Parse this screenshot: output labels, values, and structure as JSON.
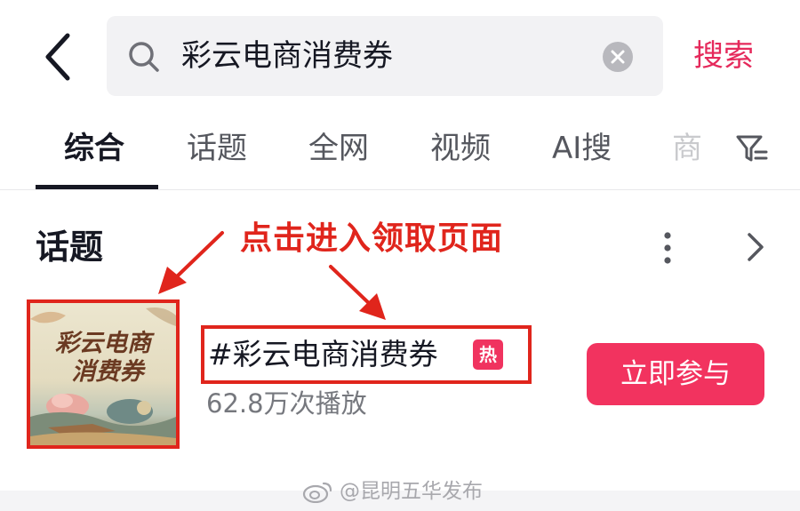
{
  "search": {
    "query": "彩云电商消费券",
    "action_label": "搜索"
  },
  "tabs": [
    {
      "label": "综合",
      "active": true
    },
    {
      "label": "话题",
      "active": false
    },
    {
      "label": "全网",
      "active": false
    },
    {
      "label": "视频",
      "active": false
    },
    {
      "label": "AI搜",
      "active": false
    },
    {
      "label": "商",
      "active": false
    }
  ],
  "section": {
    "title": "话题"
  },
  "annotation": {
    "text": "点击进入领取页面",
    "color": "#e0251c"
  },
  "topic": {
    "thumbnail_line1": "彩云电商",
    "thumbnail_line2": "消费券",
    "title": "#彩云电商消费券",
    "badge": "热",
    "plays": "62.8万次播放",
    "join_label": "立即参与"
  },
  "watermark": {
    "text": "@昆明五华发布"
  },
  "icons": {
    "back": "chevron-left-icon",
    "search": "search-icon",
    "clear": "clear-icon",
    "filter": "filter-icon",
    "more": "more-vertical-icon",
    "chevron": "chevron-right-icon",
    "weibo": "weibo-icon"
  },
  "colors": {
    "accent": "#f2335f",
    "search_action": "#e5295b",
    "annotation": "#e0251c"
  }
}
